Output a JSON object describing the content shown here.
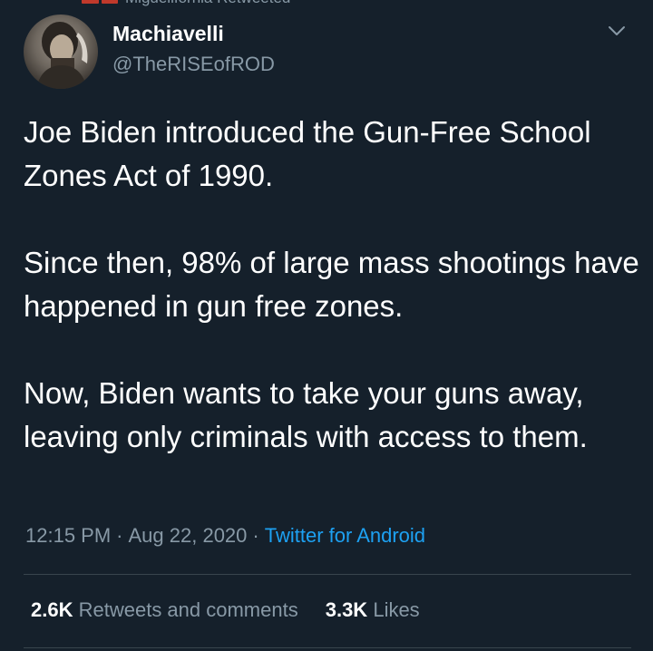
{
  "retweet_banner": {
    "text": "Miguelifornia Retweeted"
  },
  "tweet": {
    "author": {
      "name": "Machiavelli",
      "handle": "@TheRISEofROD",
      "avatar_icon": "profile-photo"
    },
    "menu_icon": "chevron-down-icon",
    "paragraphs": [
      "Joe Biden introduced the Gun-Free School Zones Act of 1990.",
      "Since then, 98% of large mass shootings have happened in gun free zones.",
      "Now, Biden wants to take your guns away, leaving only criminals with access to them."
    ],
    "time": "12:15 PM",
    "date": "Aug 22, 2020",
    "separator": "·",
    "source": "Twitter for Android",
    "retweets_count": "2.6K",
    "retweets_label": "Retweets and comments",
    "likes_count": "3.3K",
    "likes_label": "Likes"
  },
  "colors": {
    "background": "#15202b",
    "text_primary": "#ffffff",
    "text_secondary": "#8899a6",
    "link": "#1da1f2",
    "divider": "#38444d"
  }
}
